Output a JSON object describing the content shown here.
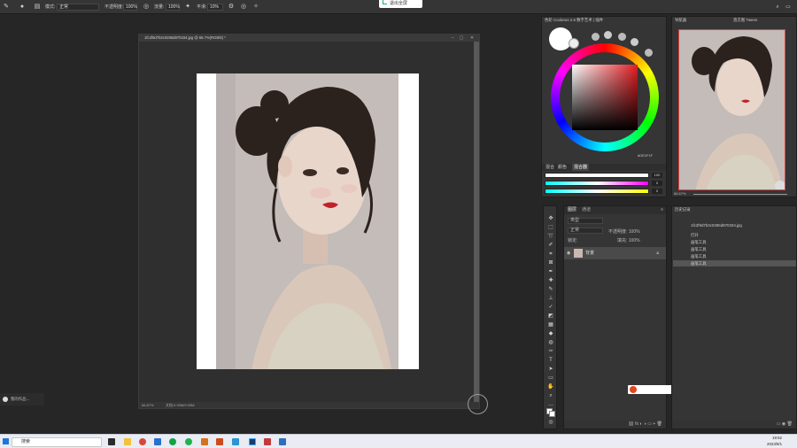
{
  "options_bar": {
    "mode_label": "模式:",
    "mode_value": "正常",
    "opacity_label": "不透明度:",
    "opacity_value": "100%",
    "flow_label": "流量:",
    "flow_value": "100%",
    "smooth_label": "平滑:",
    "smooth_value": "10%"
  },
  "notification": {
    "label": "退出全屏"
  },
  "document": {
    "tab_title": "1fc2f9d7b3c0286d870334.jpg @ 66.7%(RGB/8) *",
    "zoom": "66.67%",
    "status": "文档:9.93M/9.93M"
  },
  "color_panel": {
    "title": "色轮 Coolorus 2.6 数字艺术 | 插件",
    "tabs": [
      "混合",
      "颜色",
      "混合器"
    ],
    "values": [
      "100",
      "0",
      "0"
    ],
    "hex_small": "#DE1F1F"
  },
  "navigator": {
    "title": "导航器",
    "tab2": "直方图   Tween",
    "zoom": "66.67%"
  },
  "layers": {
    "tabs": [
      "图层",
      "通道"
    ],
    "filter_label": "类型",
    "mode_label": "正常",
    "opacity_label": "不透明度: 100%",
    "lock_label": "锁定:",
    "fill_label": "填充: 100%",
    "layer_name": "背景"
  },
  "history": {
    "title": "历史记录",
    "snapshot": "1fc2f9d7b3c0286d870334.jpg",
    "items": [
      "打开",
      "画笔工具",
      "画笔工具",
      "画笔工具",
      "画笔工具"
    ]
  },
  "floating": {
    "label": "我的作品..."
  },
  "taskbar": {
    "search_placeholder": "搜索",
    "time": "19:52",
    "date": "2023/9/1"
  },
  "colors": {
    "accent_red": "#e31c22",
    "panel": "#353535",
    "bg": "#262626"
  }
}
